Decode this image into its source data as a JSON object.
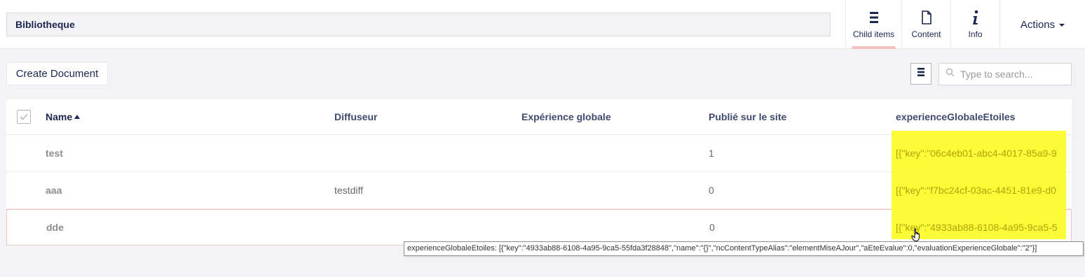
{
  "header": {
    "node_name": "Bibliotheque"
  },
  "app_tabs": [
    {
      "label": "Child items",
      "icon": "list-icon",
      "active": true
    },
    {
      "label": "Content",
      "icon": "document-icon",
      "active": false
    },
    {
      "label": "Info",
      "icon": "info-icon",
      "active": false
    }
  ],
  "actions": {
    "label": "Actions"
  },
  "toolbar": {
    "create_label": "Create Document",
    "search_placeholder": "Type to search..."
  },
  "table": {
    "columns": [
      "Name",
      "Diffuseur",
      "Expérience globale",
      "Publié sur le site",
      "experienceGlobaleEtoiles"
    ],
    "sort": {
      "column": "Name",
      "direction": "asc"
    },
    "rows": [
      {
        "name": "test",
        "diffuseur": "",
        "experience": "",
        "publie": "1",
        "etoiles": "[{\"key\":\"06c4eb01-abc4-4017-85a9-9"
      },
      {
        "name": "aaa",
        "diffuseur": "testdiff",
        "experience": "",
        "publie": "0",
        "etoiles": "[{\"key\":\"f7bc24cf-03ac-4451-81e9-d0"
      },
      {
        "name": "dde",
        "diffuseur": "",
        "experience": "",
        "publie": "0",
        "etoiles": "[{\"key\":\"4933ab88-6108-4a95-9ca5-5"
      }
    ]
  },
  "tooltip": {
    "text": "experienceGlobaleEtoiles: [{\"key\":\"4933ab88-6108-4a95-9ca5-55fda3f28848\",\"name\":\"{}\",\"ncContentTypeAlias\":\"elementMiseAJour\",\"aEteEvalue\":0,\"evaluationExperienceGlobale\":\"2\"}]"
  },
  "colors": {
    "highlight": "#fbfb38",
    "accent_tab": "#f5c1bc",
    "text_primary": "#1b264f"
  }
}
